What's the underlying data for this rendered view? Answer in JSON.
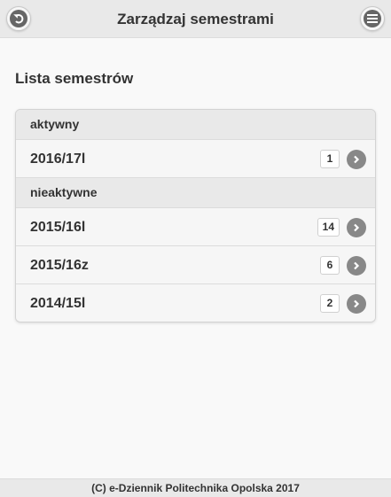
{
  "header": {
    "title": "Zarządzaj semestrami",
    "back_icon": "back-undo-icon",
    "menu_icon": "menu-icon"
  },
  "main": {
    "list_title": "Lista semestrów",
    "groups": [
      {
        "label": "aktywny",
        "items": [
          {
            "label": "2016/17l",
            "count": "1"
          }
        ]
      },
      {
        "label": "nieaktywne",
        "items": [
          {
            "label": "2015/16l",
            "count": "14"
          },
          {
            "label": "2015/16z",
            "count": "6"
          },
          {
            "label": "2014/15l",
            "count": "2"
          }
        ]
      }
    ]
  },
  "footer": {
    "text": "(C) e-Dziennik Politechnika Opolska 2017"
  }
}
